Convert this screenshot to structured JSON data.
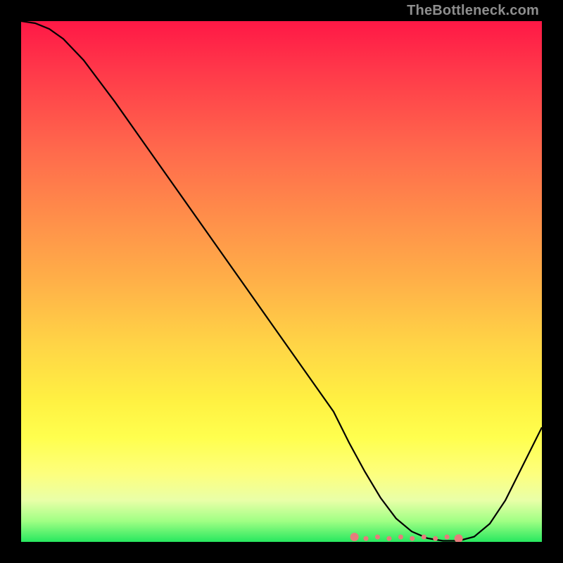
{
  "attribution": "TheBottleneck.com",
  "colors": {
    "background": "#000000",
    "gradient_top": "#ff1846",
    "gradient_mid": "#ffd446",
    "gradient_bottom": "#27e85f",
    "curve": "#000000",
    "dots": "#e77c7c"
  },
  "chart_data": {
    "type": "line",
    "title": "",
    "xlabel": "",
    "ylabel": "",
    "xlim": [
      0,
      100
    ],
    "ylim": [
      0,
      100
    ],
    "x": [
      0,
      2.7,
      5.4,
      8.1,
      12,
      18,
      24,
      30,
      36,
      42,
      48,
      54,
      60,
      63,
      66,
      69,
      72,
      75,
      78,
      81,
      84,
      87,
      90,
      93,
      96,
      100
    ],
    "values": [
      100,
      99.6,
      98.5,
      96.6,
      92.5,
      84.5,
      76,
      67.5,
      59,
      50.5,
      42,
      33.5,
      25,
      19,
      13.5,
      8.5,
      4.5,
      2,
      0.7,
      0.2,
      0.2,
      1,
      3.5,
      8,
      14,
      22
    ],
    "annotations": {
      "highlight_region": {
        "x_range": [
          64,
          84
        ],
        "approx_y": 0.8,
        "dot_count": 10
      }
    }
  }
}
